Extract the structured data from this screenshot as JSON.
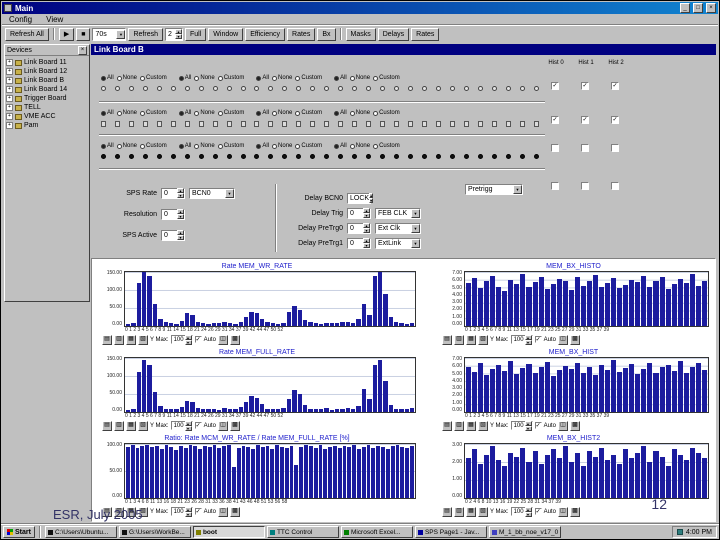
{
  "window": {
    "title": "Main"
  },
  "menu": {
    "config": "Config",
    "view": "View"
  },
  "toolbar": {
    "items": [
      {
        "type": "button",
        "label": "Refresh All"
      },
      {
        "type": "sep"
      },
      {
        "type": "button",
        "label": "▶"
      },
      {
        "type": "button",
        "label": "■"
      },
      {
        "type": "combo",
        "label": "70s"
      },
      {
        "type": "button",
        "label": "Refresh"
      },
      {
        "type": "spin",
        "label": "2"
      },
      {
        "type": "button",
        "label": "Full"
      },
      {
        "type": "button",
        "label": "Window"
      },
      {
        "type": "button",
        "label": "Efficiency"
      },
      {
        "type": "button",
        "label": "Rates"
      },
      {
        "type": "button",
        "label": "Bx"
      },
      {
        "type": "sep"
      },
      {
        "type": "button",
        "label": "Masks"
      },
      {
        "type": "button",
        "label": "Delays"
      },
      {
        "type": "button",
        "label": "Rates"
      }
    ]
  },
  "devices": {
    "title": "Devices",
    "items": [
      {
        "label": "Link Board 11"
      },
      {
        "label": "Link Board 12"
      },
      {
        "label": "Link Board B"
      },
      {
        "label": "Link Board 14"
      },
      {
        "label": "Trigger Board"
      },
      {
        "label": "TELL"
      },
      {
        "label": "VME ACC"
      },
      {
        "label": "Pam"
      }
    ]
  },
  "board": {
    "title": "Link Board B",
    "mask": {
      "options": [
        "All",
        "None",
        "Custom"
      ],
      "groups_per_row": 4,
      "dots": 32,
      "bands": [
        {
          "selected": 0,
          "dot_style": "hollow"
        },
        {
          "selected": 0,
          "dot_style": "square"
        },
        {
          "selected": 0,
          "dot_style": "filled"
        }
      ],
      "hist_headers": [
        "Hist 0",
        "Hist 1",
        "Hist 2"
      ],
      "hist_rows": [
        [
          true,
          true,
          true
        ],
        [
          true,
          true,
          true
        ],
        [
          false,
          false,
          false
        ],
        [
          false,
          false,
          false
        ]
      ]
    },
    "settings": {
      "sps_rate": {
        "label": "SPS Rate",
        "value": "0"
      },
      "bcn0_select": "BCN0",
      "resolution": {
        "label": "Resolution",
        "value": "0"
      },
      "sps_active": {
        "label": "SPS Active",
        "value": "0"
      },
      "delay_bcn0": {
        "label": "Delay BCN0",
        "value": "LOCK"
      },
      "delay_trig": {
        "label": "Delay Trig",
        "value": "0",
        "select": "FEB CLK"
      },
      "delay_pretrg0": {
        "label": "Delay PreTrg0",
        "value": "0",
        "select": "Ext Clk"
      },
      "delay_pretrg1": {
        "label": "Delay PreTrg1",
        "value": "0",
        "select": "ExtLink"
      },
      "pretrigger_select": "Pretrigg"
    }
  },
  "chart_toolbar": {
    "ymax_label": "Y Max:",
    "auto_label": "Auto",
    "icons": [
      {
        "name": "save-icon",
        "glyph": "▤"
      },
      {
        "name": "print-icon",
        "glyph": "▥"
      },
      {
        "name": "copy-icon",
        "glyph": "▦"
      },
      {
        "name": "settings-icon",
        "glyph": "▧"
      }
    ],
    "trailing_icons": [
      {
        "name": "zoom-icon",
        "glyph": "◫"
      },
      {
        "name": "color-icon",
        "glyph": "▩"
      }
    ]
  },
  "chart_data": [
    {
      "type": "bar",
      "title": "Rate MEM_WR_RATE",
      "ylim": 150,
      "yticks": [
        "150.00",
        "100.00",
        "50.00",
        "0.00"
      ],
      "xticks": "0 1 2 3 4 5 6 7 8 9 11 14 15 18 21 24 26 29 31 34 37 39 42 44 47 50 52",
      "ymax": "100",
      "values": [
        6,
        8,
        120,
        150,
        140,
        60,
        20,
        10,
        8,
        6,
        15,
        35,
        30,
        12,
        8,
        6,
        9,
        7,
        10,
        8,
        6,
        12,
        25,
        40,
        35,
        20,
        10,
        8,
        6,
        9,
        40,
        55,
        45,
        18,
        10,
        8,
        6,
        9,
        7,
        8,
        10,
        12,
        8,
        20,
        60,
        30,
        140,
        150,
        90,
        25,
        10,
        8,
        6,
        9
      ]
    },
    {
      "type": "bar",
      "title": "MEM_BX_HISTO",
      "ylim": 7,
      "yticks": [
        "7.00",
        "6.00",
        "5.00",
        "4.00",
        "3.00",
        "2.00",
        "1.00",
        "0.00"
      ],
      "xticks": "0 1 2 3 4 5 6 7 8 9 11 13 15 17 19 21 23 25 27 29 31 33 35 37 39",
      "ymax": "100",
      "values": [
        5.6,
        6.2,
        4.9,
        5.8,
        6.5,
        5.1,
        4.6,
        6.0,
        5.4,
        6.8,
        5.0,
        5.7,
        6.3,
        4.8,
        5.5,
        6.1,
        5.9,
        4.7,
        6.4,
        5.2,
        5.8,
        6.6,
        5.0,
        5.6,
        6.2,
        4.9,
        5.3,
        6.0,
        5.7,
        6.5,
        5.1,
        5.9,
        6.3,
        4.8,
        5.4,
        6.1,
        5.6,
        6.7,
        5.2,
        5.8
      ]
    },
    {
      "type": "bar",
      "title": "Rate MEM_FULL_RATE",
      "ylim": 150,
      "yticks": [
        "150.00",
        "100.00",
        "50.00",
        "0.00"
      ],
      "xticks": "0 1 2 3 4 5 6 7 8 9 11 14 15 18 21 24 26 29 31 34 37 39 42 44 47 50 52",
      "ymax": "100",
      "values": [
        6,
        9,
        110,
        145,
        130,
        55,
        18,
        9,
        7,
        8,
        14,
        30,
        28,
        10,
        7,
        9,
        8,
        6,
        11,
        7,
        9,
        14,
        28,
        45,
        38,
        22,
        9,
        7,
        8,
        10,
        35,
        60,
        50,
        20,
        9,
        7,
        8,
        10,
        6,
        8,
        9,
        11,
        7,
        18,
        65,
        35,
        130,
        145,
        85,
        20,
        9,
        7,
        8,
        10
      ]
    },
    {
      "type": "bar",
      "title": "MEM_BX_HIST",
      "ylim": 7,
      "yticks": [
        "7.00",
        "6.00",
        "5.00",
        "4.00",
        "3.00",
        "2.00",
        "1.00",
        "0.00"
      ],
      "xticks": "0 1 2 3 4 5 6 7 8 9 11 13 15 17 19 21 23 25 27 29 31 33 35 37 39",
      "ymax": "100",
      "values": [
        5.9,
        5.2,
        6.4,
        4.8,
        5.6,
        6.1,
        5.3,
        6.6,
        4.9,
        5.7,
        6.2,
        5.0,
        5.8,
        6.5,
        4.7,
        5.4,
        6.0,
        5.6,
        6.3,
        5.1,
        5.9,
        4.8,
        6.1,
        5.5,
        6.7,
        5.2,
        5.7,
        6.2,
        4.9,
        5.6,
        6.4,
        5.0,
        5.8,
        6.1,
        5.3,
        6.6,
        5.1,
        5.9,
        6.3,
        5.5
      ]
    },
    {
      "type": "bar",
      "title": "Ratio: Rate MCM_WR_RATE / Rate MEM_FULL_RATE [%]",
      "ylim": 100,
      "yticks": [
        "100.00",
        "50.00",
        "0.00"
      ],
      "xticks": "0 1 3 4 6 8 11 13 16 18 21 23 26 28 31 33 36 38 41 43 46 48 51 53 56 58",
      "ymax": "100",
      "values": [
        95,
        98,
        92,
        97,
        99,
        94,
        96,
        91,
        98,
        95,
        88,
        97,
        93,
        99,
        96,
        90,
        97,
        94,
        98,
        92,
        96,
        99,
        57,
        93,
        97,
        95,
        91,
        98,
        94,
        96,
        90,
        99,
        95,
        92,
        97,
        61,
        94,
        98,
        96,
        93,
        99,
        91,
        95,
        97,
        92,
        96,
        94,
        98,
        90,
        95,
        99,
        93,
        97,
        95,
        91,
        96,
        98,
        94,
        92,
        97
      ]
    },
    {
      "type": "bar",
      "title": "MEM_BX_HIST2",
      "ylim": 3,
      "yticks": [
        "3.00",
        "2.00",
        "1.00",
        "0.00"
      ],
      "xticks": "0 2 4 6 8 10 13 16 19 22 25 28 31 34 37 39",
      "ymax": "100",
      "values": [
        2.2,
        2.7,
        1.9,
        2.4,
        2.9,
        2.1,
        1.8,
        2.5,
        2.3,
        2.8,
        2.0,
        2.6,
        1.9,
        2.4,
        2.7,
        2.2,
        2.9,
        2.0,
        2.5,
        1.8,
        2.6,
        2.3,
        2.8,
        2.1,
        2.4,
        1.9,
        2.7,
        2.2,
        2.5,
        2.9,
        2.0,
        2.6,
        2.3,
        1.8,
        2.7,
        2.4,
        2.1,
        2.8,
        2.5,
        2.2
      ]
    }
  ],
  "footer": {
    "left": "ESR, July 2005",
    "page": "12"
  },
  "taskbar": {
    "start": "Start",
    "tasks": [
      {
        "label": "C:\\Users\\Ubuntu...",
        "icon": "console-icon",
        "icon_color": "#101010"
      },
      {
        "label": "G:\\Users\\WorkBe...",
        "icon": "console-icon",
        "icon_color": "#101010"
      },
      {
        "label": "boot",
        "icon": "app-icon",
        "icon_color": "#808000",
        "active": true
      },
      {
        "label": "TTC Control",
        "icon": "app-icon",
        "icon_color": "#008080"
      },
      {
        "label": "Microsoft Excel...",
        "icon": "excel-icon",
        "icon_color": "#008000"
      },
      {
        "label": "SPS Page1 - Jav...",
        "icon": "browser-icon",
        "icon_color": "#0000a0"
      },
      {
        "label": "M_1_bb_noe_v17_0...",
        "icon": "doc-icon",
        "icon_color": "#4040c0"
      }
    ],
    "active_task": 2,
    "clock": "4:00 PM"
  }
}
